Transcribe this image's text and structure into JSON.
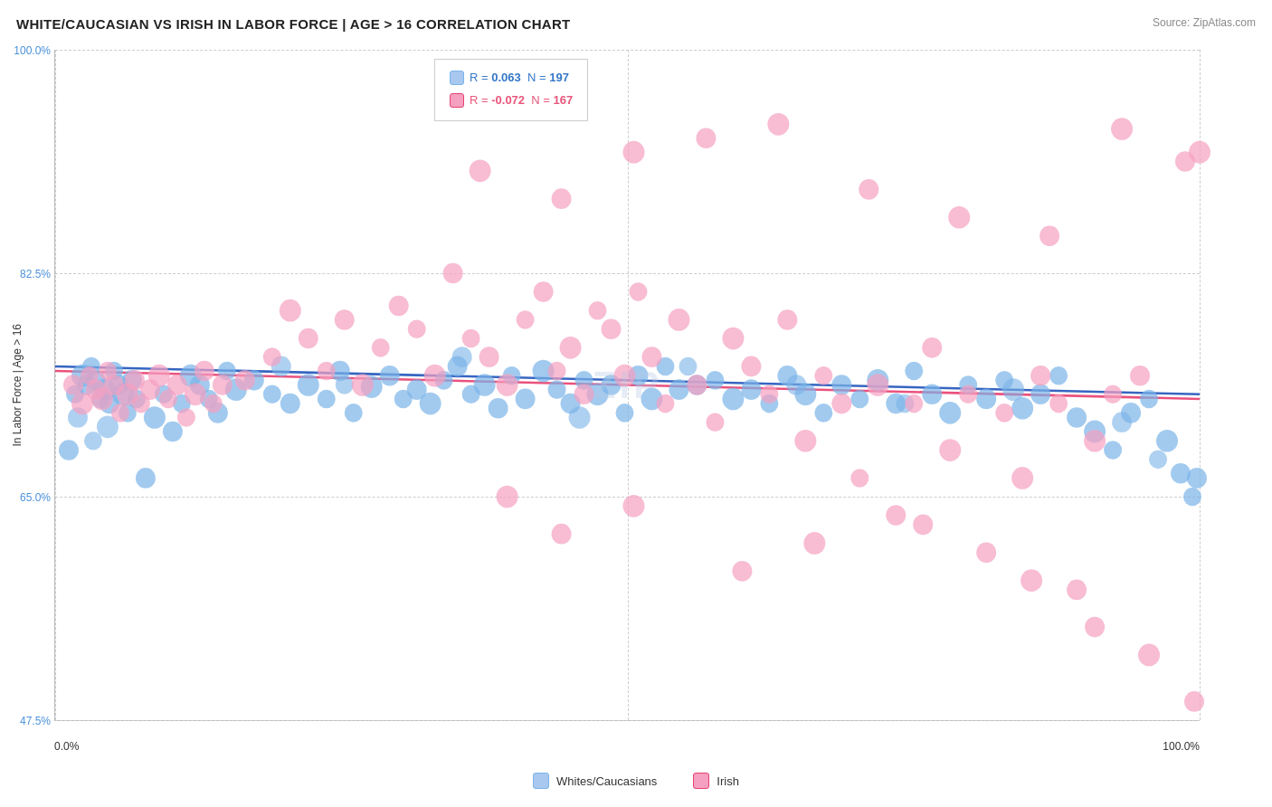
{
  "title": "WHITE/CAUCASIAN VS IRISH IN LABOR FORCE | AGE > 16 CORRELATION CHART",
  "source": "Source: ZipAtlas.com",
  "y_axis_title": "In Labor Force | Age > 16",
  "legend": {
    "blue": {
      "r_label": "R =",
      "r_value": "0.063",
      "n_label": "N =",
      "n_value": "197"
    },
    "pink": {
      "r_label": "R =",
      "r_value": "-0.072",
      "n_label": "N =",
      "n_value": "167"
    }
  },
  "y_axis_labels": [
    "100.0%",
    "82.5%",
    "65.0%",
    "47.5%"
  ],
  "x_axis_labels": [
    "0.0%",
    "100.0%"
  ],
  "bottom_legend": {
    "item1": "Whites/Caucasians",
    "item2": "Irish"
  },
  "watermark": "ZIP",
  "colors": {
    "blue_dot": "#7ab3e8",
    "pink_dot": "#f0a0b8",
    "blue_line": "#2255bb",
    "pink_line": "#e84070",
    "blue_swatch": "#a8c8f0",
    "pink_swatch": "#f5a0c0"
  }
}
